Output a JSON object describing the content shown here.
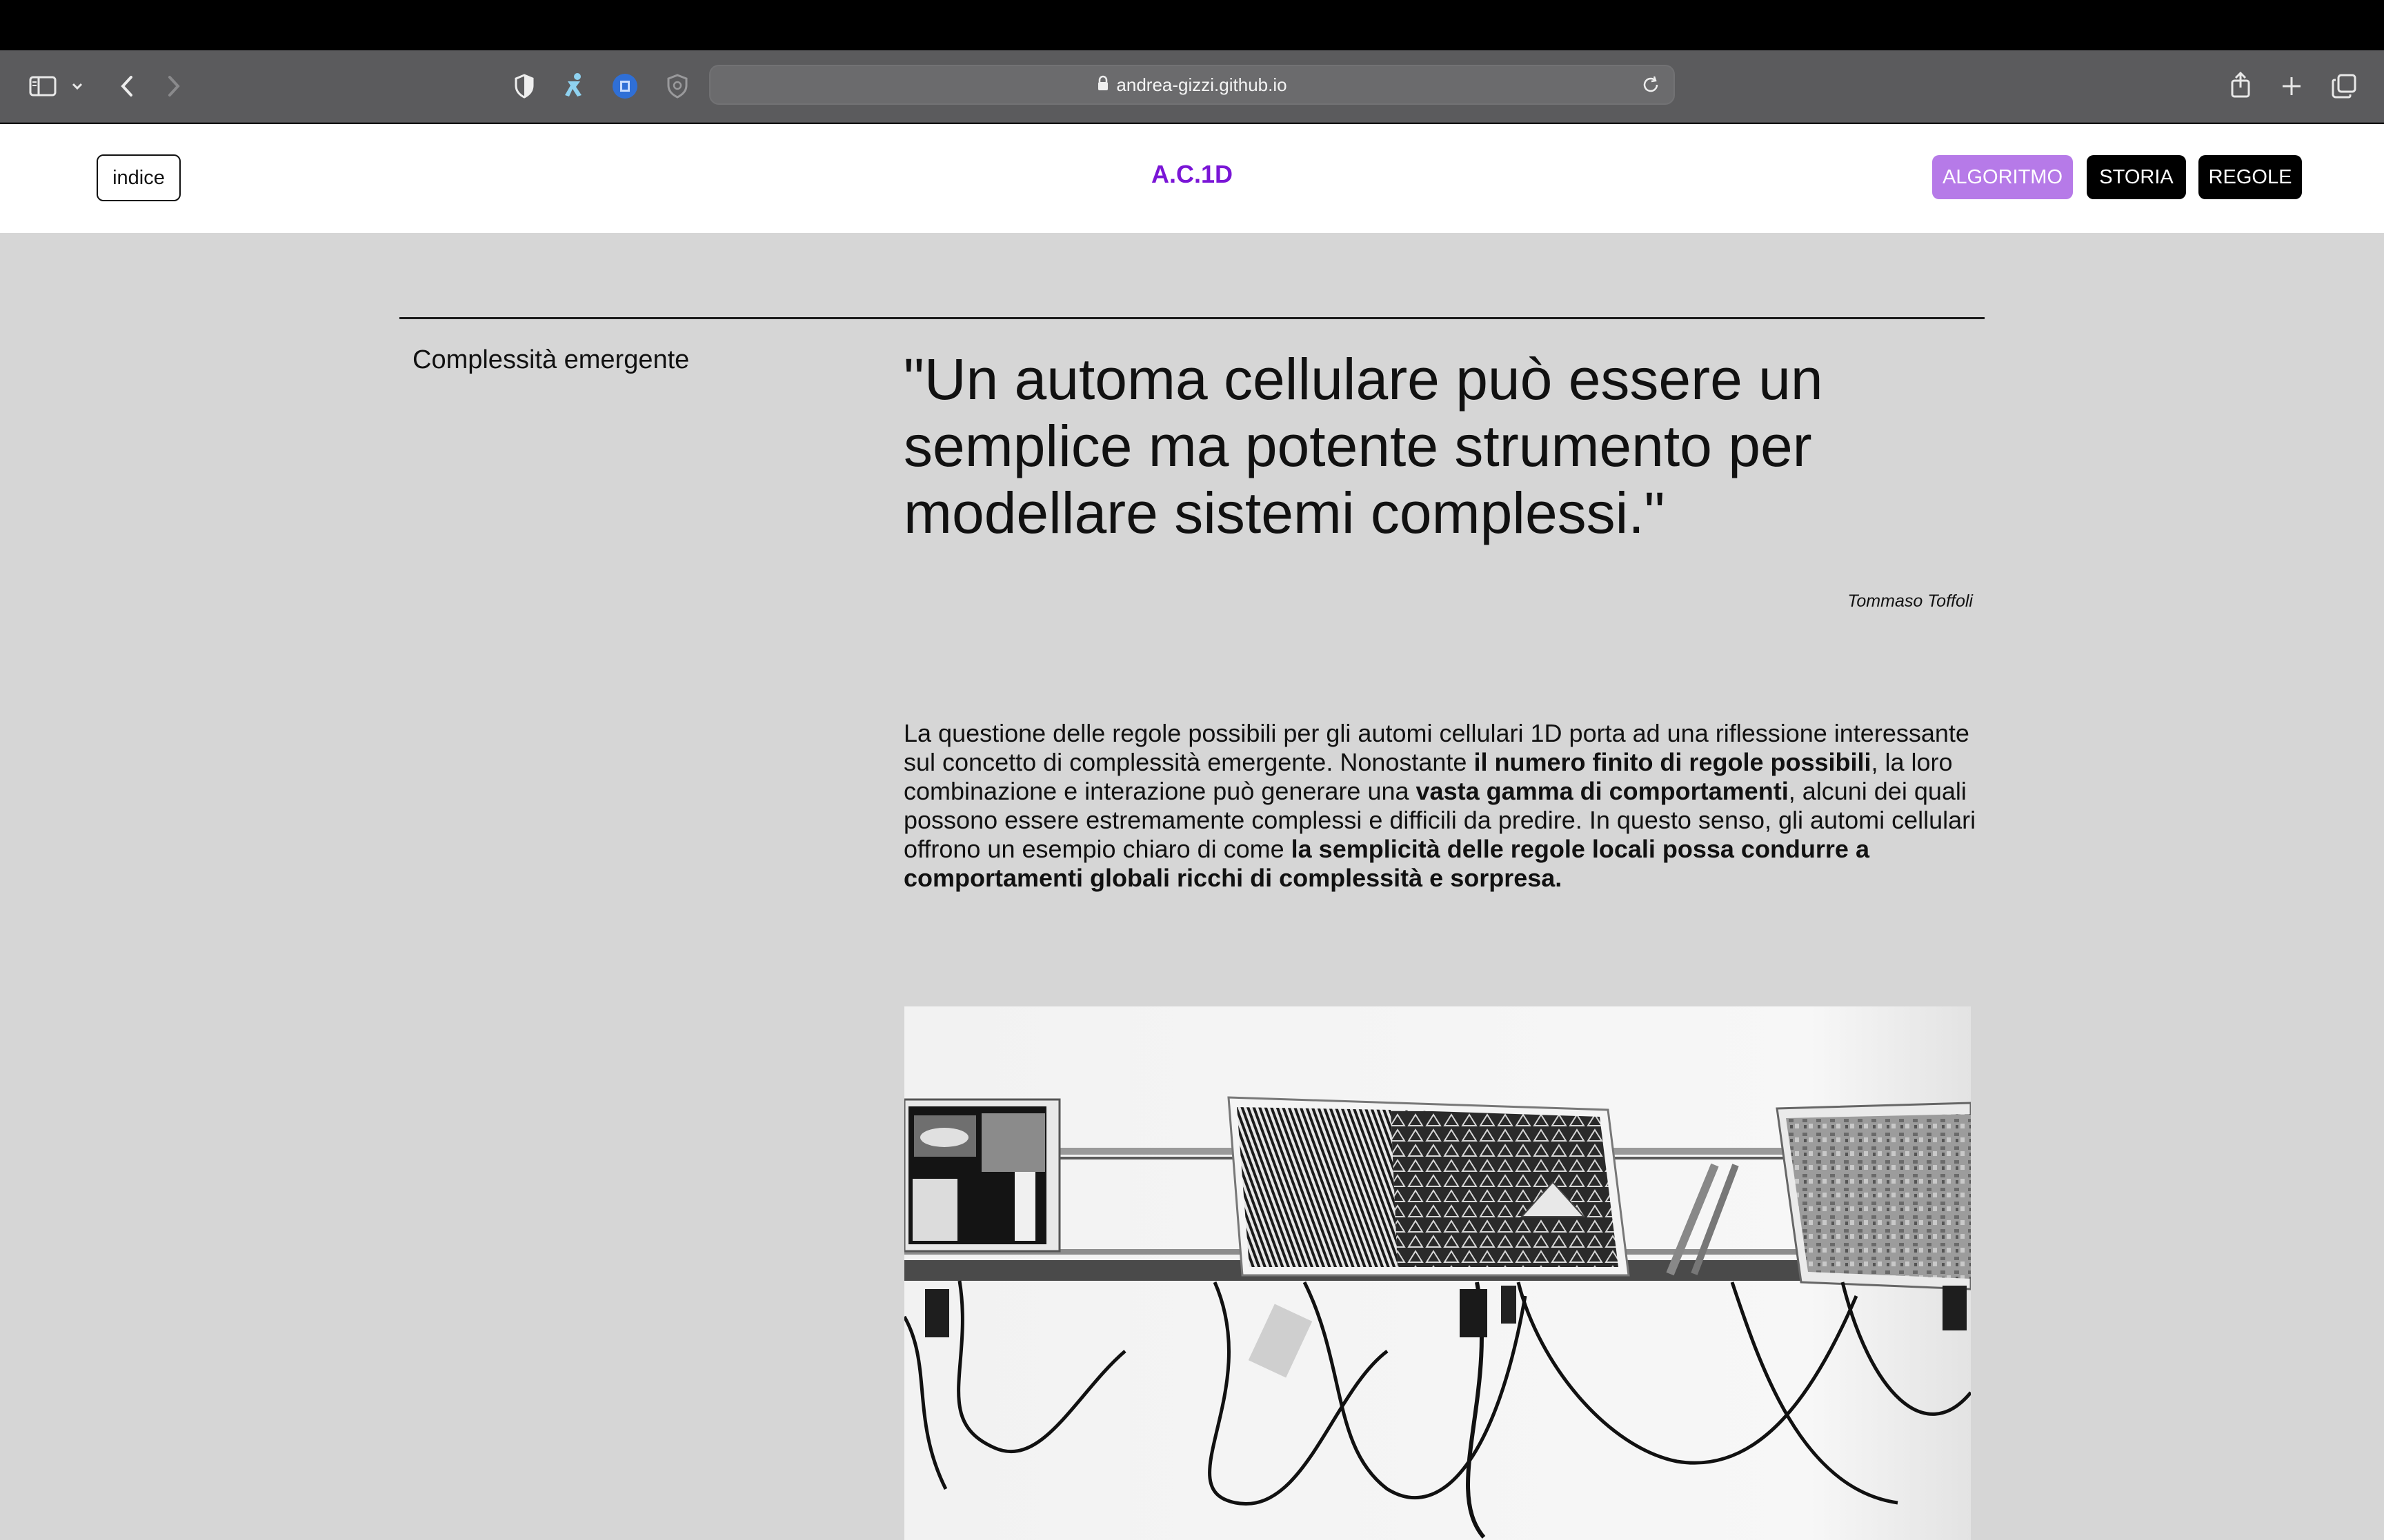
{
  "browser": {
    "url": "andrea-gizzi.github.io"
  },
  "header": {
    "index_button": "indice",
    "site_title": "A.C.1D",
    "nav": [
      {
        "label": "ALGORITMO",
        "active": true,
        "color": "#b67ae8"
      },
      {
        "label": "STORIA",
        "active": false,
        "color": "#000000"
      },
      {
        "label": "REGOLE",
        "active": false,
        "color": "#000000"
      }
    ],
    "title_color": "#7a15d6"
  },
  "content": {
    "section_label": "Complessità emergente",
    "quote": "\"Un automa cellulare può essere un semplice ma potente strumento per modellare sistemi complessi.\"",
    "quote_author": "Tommaso Toffoli",
    "paragraph": [
      {
        "text": "La questione delle regole possibili per gli automi cellulari 1D porta ad una riflessione interessante sul concetto di complessità emergente. Nonostante ",
        "bold": false
      },
      {
        "text": "il numero finito di regole possibili",
        "bold": true
      },
      {
        "text": ", la loro combinazione e interazione può generare una ",
        "bold": false
      },
      {
        "text": "vasta gamma di comportamenti",
        "bold": true
      },
      {
        "text": ", alcuni dei quali possono essere estremamente complessi e difficili da predire. In questo senso, gli automi cellulari offrono un esempio chiaro di come ",
        "bold": false
      },
      {
        "text": "la semplicità delle regole locali possa condurre a comportamenti globali ricchi di complessità e sorpresa.",
        "bold": true
      }
    ],
    "background_color": "#d6d6d6"
  },
  "icons": [
    "sidebar-toggle-icon",
    "chevron-down-icon",
    "back-arrow-icon",
    "forward-arrow-icon",
    "shield-half-icon",
    "extension-runner-icon",
    "extension-blue-icon",
    "privacy-shield-icon",
    "lock-icon",
    "reload-icon",
    "share-icon",
    "new-tab-plus-icon",
    "tab-overview-icon"
  ]
}
